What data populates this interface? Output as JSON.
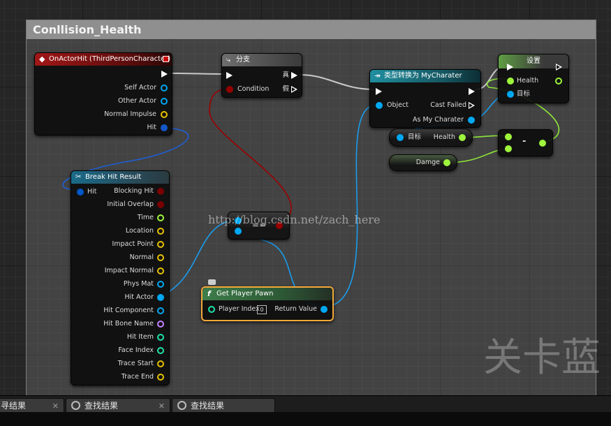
{
  "comment": {
    "title": "Conllision_Health"
  },
  "nodes": {
    "on_actor_hit": {
      "title": "OnActorHit (ThirdPersonCharacter)",
      "pins": [
        "Self Actor",
        "Other Actor",
        "Normal Impulse",
        "Hit"
      ]
    },
    "branch": {
      "title": "分支",
      "condition": "Condition",
      "true_label": "真",
      "false_label": "假"
    },
    "cast": {
      "title": "类型转换为 MyCharater",
      "object": "Object",
      "cast_failed": "Cast Failed",
      "as_char": "As My Charater"
    },
    "set": {
      "title": "设置",
      "health": "Health",
      "target": "目标"
    },
    "get_health": {
      "target": "目标",
      "health": "Health"
    },
    "damge": {
      "label": "Damge"
    },
    "subtract": {
      "label": "-"
    },
    "equal": {
      "label": "=="
    },
    "break_hit": {
      "title": "Break Hit Result",
      "hit": "Hit",
      "outputs": [
        "Blocking Hit",
        "Initial Overlap",
        "Time",
        "Location",
        "Impact Point",
        "Normal",
        "Impact Normal",
        "Phys Mat",
        "Hit Actor",
        "Hit Component",
        "Hit Bone Name",
        "Hit Item",
        "Face Index",
        "Trace Start",
        "Trace End"
      ]
    },
    "get_player_pawn": {
      "title": "Get Player Pawn",
      "player_index": "Player Index",
      "player_index_value": "0",
      "return_value": "Return Value"
    }
  },
  "watermarks": {
    "url": "http://blog.csdn.net/zach_here",
    "brand": "关卡蓝"
  },
  "tabs": [
    {
      "label": "寻结果"
    },
    {
      "label": "查找结果"
    },
    {
      "label": "查找结果"
    }
  ],
  "colors": {
    "exec": "#ffffff",
    "bool": "#950000",
    "object": "#00a8f2",
    "float": "#9ef53c",
    "vector": "#e6c100",
    "name": "#c882ff",
    "int": "#1fe3aa",
    "struct": "#0057c8"
  }
}
